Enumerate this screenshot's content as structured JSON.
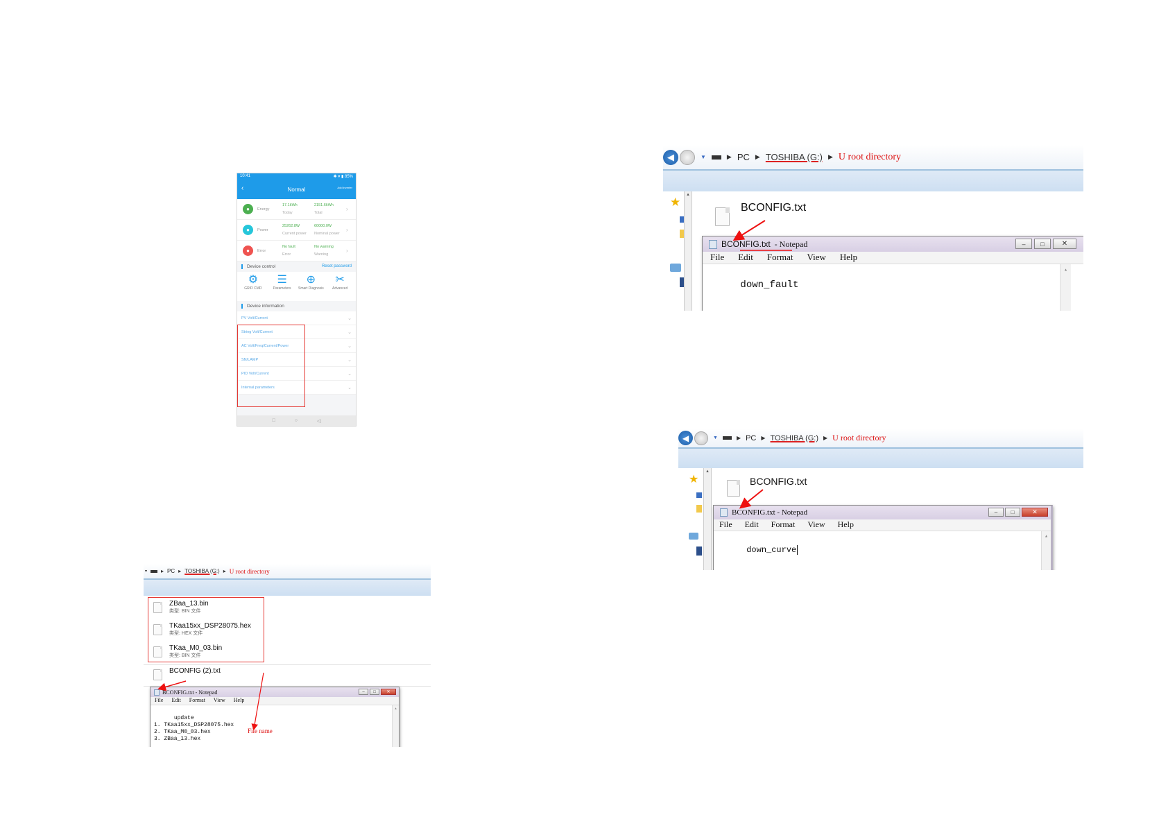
{
  "phone": {
    "status_left": "10:41",
    "status_right": "✱ ▾ ▮ 85%",
    "header_title": "Normal",
    "header_right": "Add inverter",
    "metrics": [
      {
        "name": "Energy",
        "color": "#4caf50",
        "v1": "17.1kWh",
        "s1": "Today",
        "v2": "2151.6kWh",
        "s2": "Total"
      },
      {
        "name": "Power",
        "color": "#26c6da",
        "v1": "25262.8W",
        "s1": "Current power",
        "v2": "60000.0W",
        "s2": "Nominal power"
      },
      {
        "name": "Error",
        "color": "#ef5350",
        "v1": "No fault",
        "s1": "Error",
        "v2": "No warning",
        "s2": "Warning"
      }
    ],
    "device_control": "Device control",
    "reset_password": "Reset password",
    "controls": [
      {
        "label": "GRID CMD",
        "glyph": "⚙"
      },
      {
        "label": "Parameters",
        "glyph": "☰"
      },
      {
        "label": "Smart Diagnosis",
        "glyph": "⊕"
      },
      {
        "label": "Advanced",
        "glyph": "✂"
      }
    ],
    "device_information": "Device information",
    "info_rows": [
      "PV Volt/Current",
      "String Volt/Current",
      "AC Volt/Freq/Current/Power",
      "SN/LAMP",
      "PID Volt/Current",
      "Internal parameters"
    ],
    "nav": [
      "□",
      "○",
      "◁"
    ]
  },
  "explorer_common": {
    "path_pc": "PC",
    "path_drive": "TOSHIBA (G:)",
    "path_root": "U root directory",
    "notepad_menu": [
      "File",
      "Edit",
      "Format",
      "View",
      "Help"
    ]
  },
  "explorer_left": {
    "files": [
      {
        "name": "ZBaa_13.bin",
        "type": "类型: BIN 文件"
      },
      {
        "name": "TKaa15xx_DSP28075.hex",
        "type": "类型: HEX 文件"
      },
      {
        "name": "TKaa_M0_03.bin",
        "type": "类型: BIN 文件"
      },
      {
        "name": "BCONFIG (2).txt",
        "type": ""
      }
    ],
    "notepad_title": "BCONFIG.txt - Notepad",
    "notepad_content": "update\n1. TKaa15xx_DSP28075.hex\n2. TKaa_M0_03.hex\n3. ZBaa_13.hex",
    "annotation": "File name"
  },
  "explorer_top_right": {
    "file": "BCONFIG.txt",
    "notepad_title_a": "BCONFIG.txt",
    "notepad_title_b": "- Notepad",
    "notepad_content": "down_fault"
  },
  "explorer_bottom_right": {
    "file": "BCONFIG.txt",
    "notepad_title": "BCONFIG.txt - Notepad",
    "notepad_content": "down_curve"
  }
}
